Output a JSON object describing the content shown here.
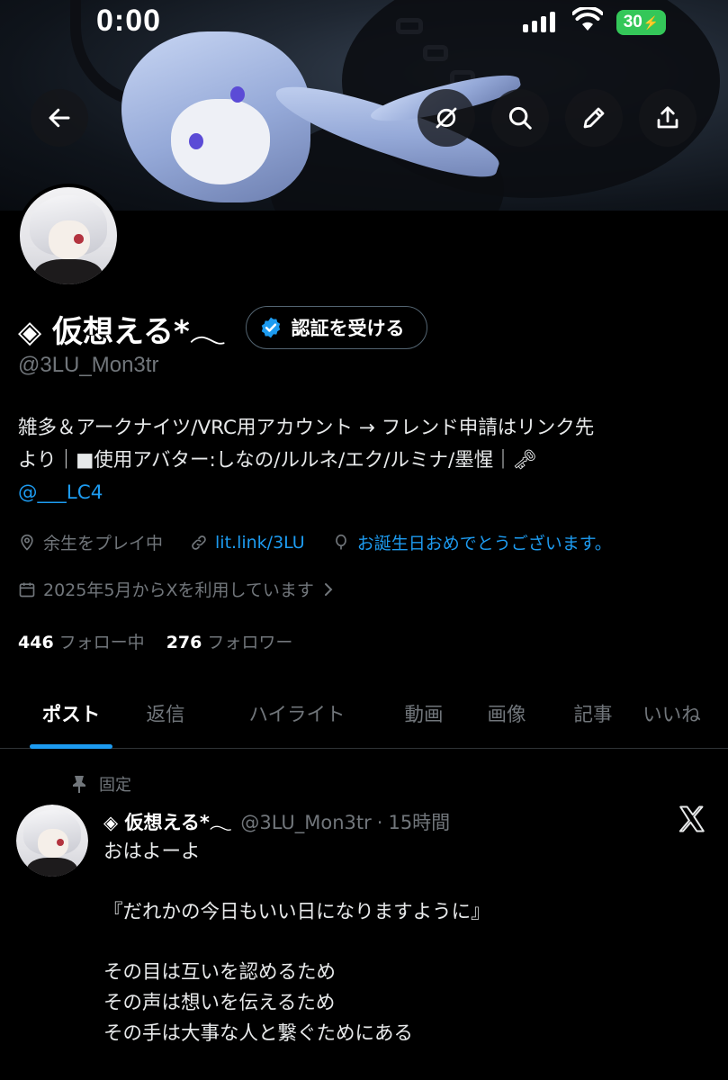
{
  "status_bar": {
    "time": "0:00",
    "battery": "30"
  },
  "profile": {
    "name": "◈ 仮想える*𓂃",
    "verify_label": "認証を受ける",
    "handle": "@3LU_Mon3tr",
    "bio_lines": [
      "雑多＆アークナイツ/VRC用アカウント → フレンド申請はリンク先",
      "より｜■使用アバター:しなの/ルルネ/エク/ルミナ/墨惺｜🗝"
    ],
    "bio_mention": "@___LC4",
    "location": "余生をプレイ中",
    "link": "lit.link/3LU",
    "birthday": "お誕生日おめでとうございます。",
    "joined": "2025年5月からXを利用しています",
    "following_count": "446",
    "following_label": "フォロー中",
    "followers_count": "276",
    "followers_label": "フォロワー"
  },
  "tabs": [
    "ポスト",
    "返信",
    "ハイライト",
    "動画",
    "画像",
    "記事",
    "いいね"
  ],
  "pinned_post": {
    "pinned_label": "固定",
    "author_name": "◈ 仮想える*𓂃",
    "author_handle": "@3LU_Mon3tr",
    "separator": "·",
    "time": "15時間",
    "text": "おはよーよ\n\n『だれかの今日もいい日になりますように』\n\nその目は互いを認めるため\nその声は想いを伝えるため\nその手は大事な人と繋ぐためにある"
  },
  "colors": {
    "accent": "#1d9bf0",
    "muted": "#71767b",
    "background": "#000000",
    "battery": "#34c759"
  }
}
